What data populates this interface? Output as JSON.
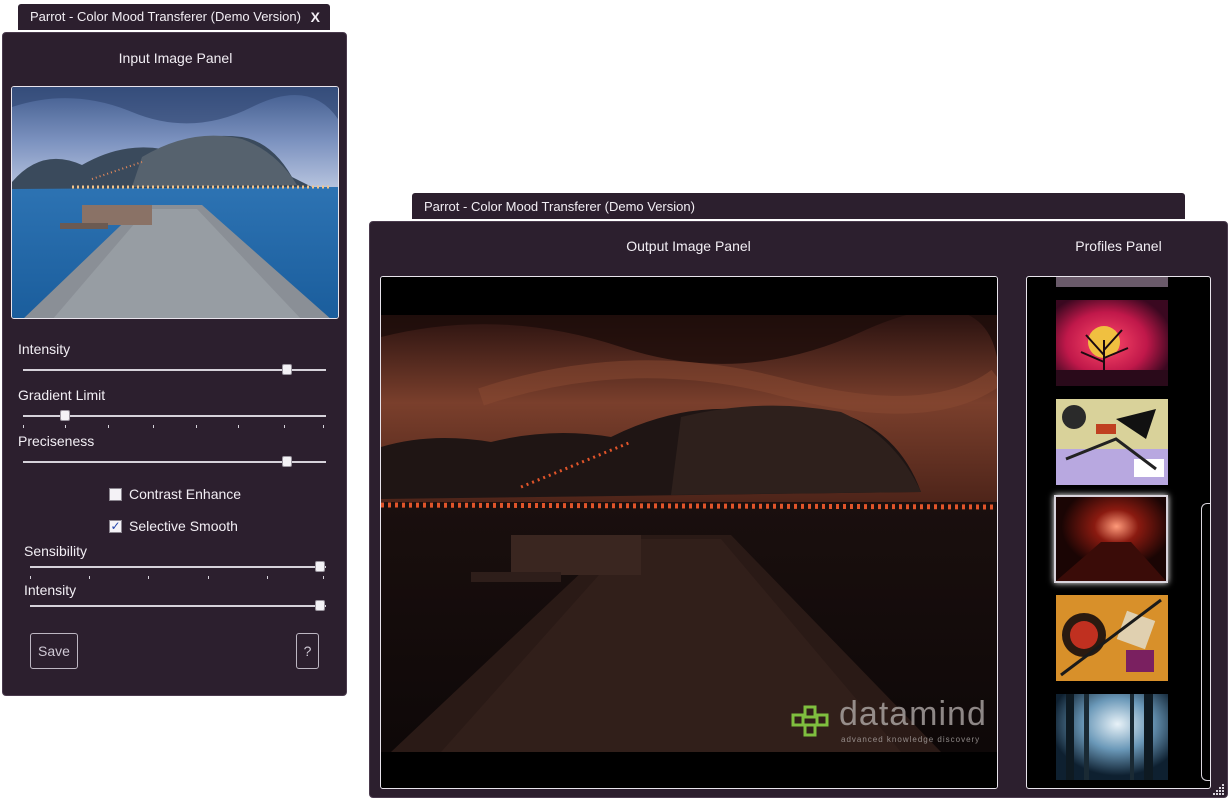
{
  "input_window": {
    "title": "Parrot - Color Mood Transferer (Demo Version)",
    "close_label": "X",
    "panel_title": "Input Image Panel",
    "controls": {
      "intensity": {
        "label": "Intensity",
        "value_percent": 87
      },
      "gradient_limit": {
        "label": "Gradient Limit",
        "value_percent": 14
      },
      "preciseness": {
        "label": "Preciseness",
        "value_percent": 87
      },
      "contrast_enhance": {
        "label": "Contrast Enhance",
        "checked": false
      },
      "selective_smooth": {
        "label": "Selective Smooth",
        "checked": true,
        "check_glyph": "✓"
      },
      "sensibility": {
        "label": "Sensibility",
        "value_percent": 98
      },
      "intensity2": {
        "label": "Intensity",
        "value_percent": 98
      }
    },
    "save_label": "Save",
    "help_label": "?"
  },
  "output_window": {
    "title": "Parrot - Color Mood Transferer (Demo Version)",
    "output_title": "Output Image Panel",
    "profiles_title": "Profiles Panel"
  },
  "watermark": {
    "brand": "datamind",
    "tagline": "advanced knowledge discovery"
  },
  "colors": {
    "window_bg": "#2c1f2e",
    "watermark_green": "#7fbf3f"
  }
}
